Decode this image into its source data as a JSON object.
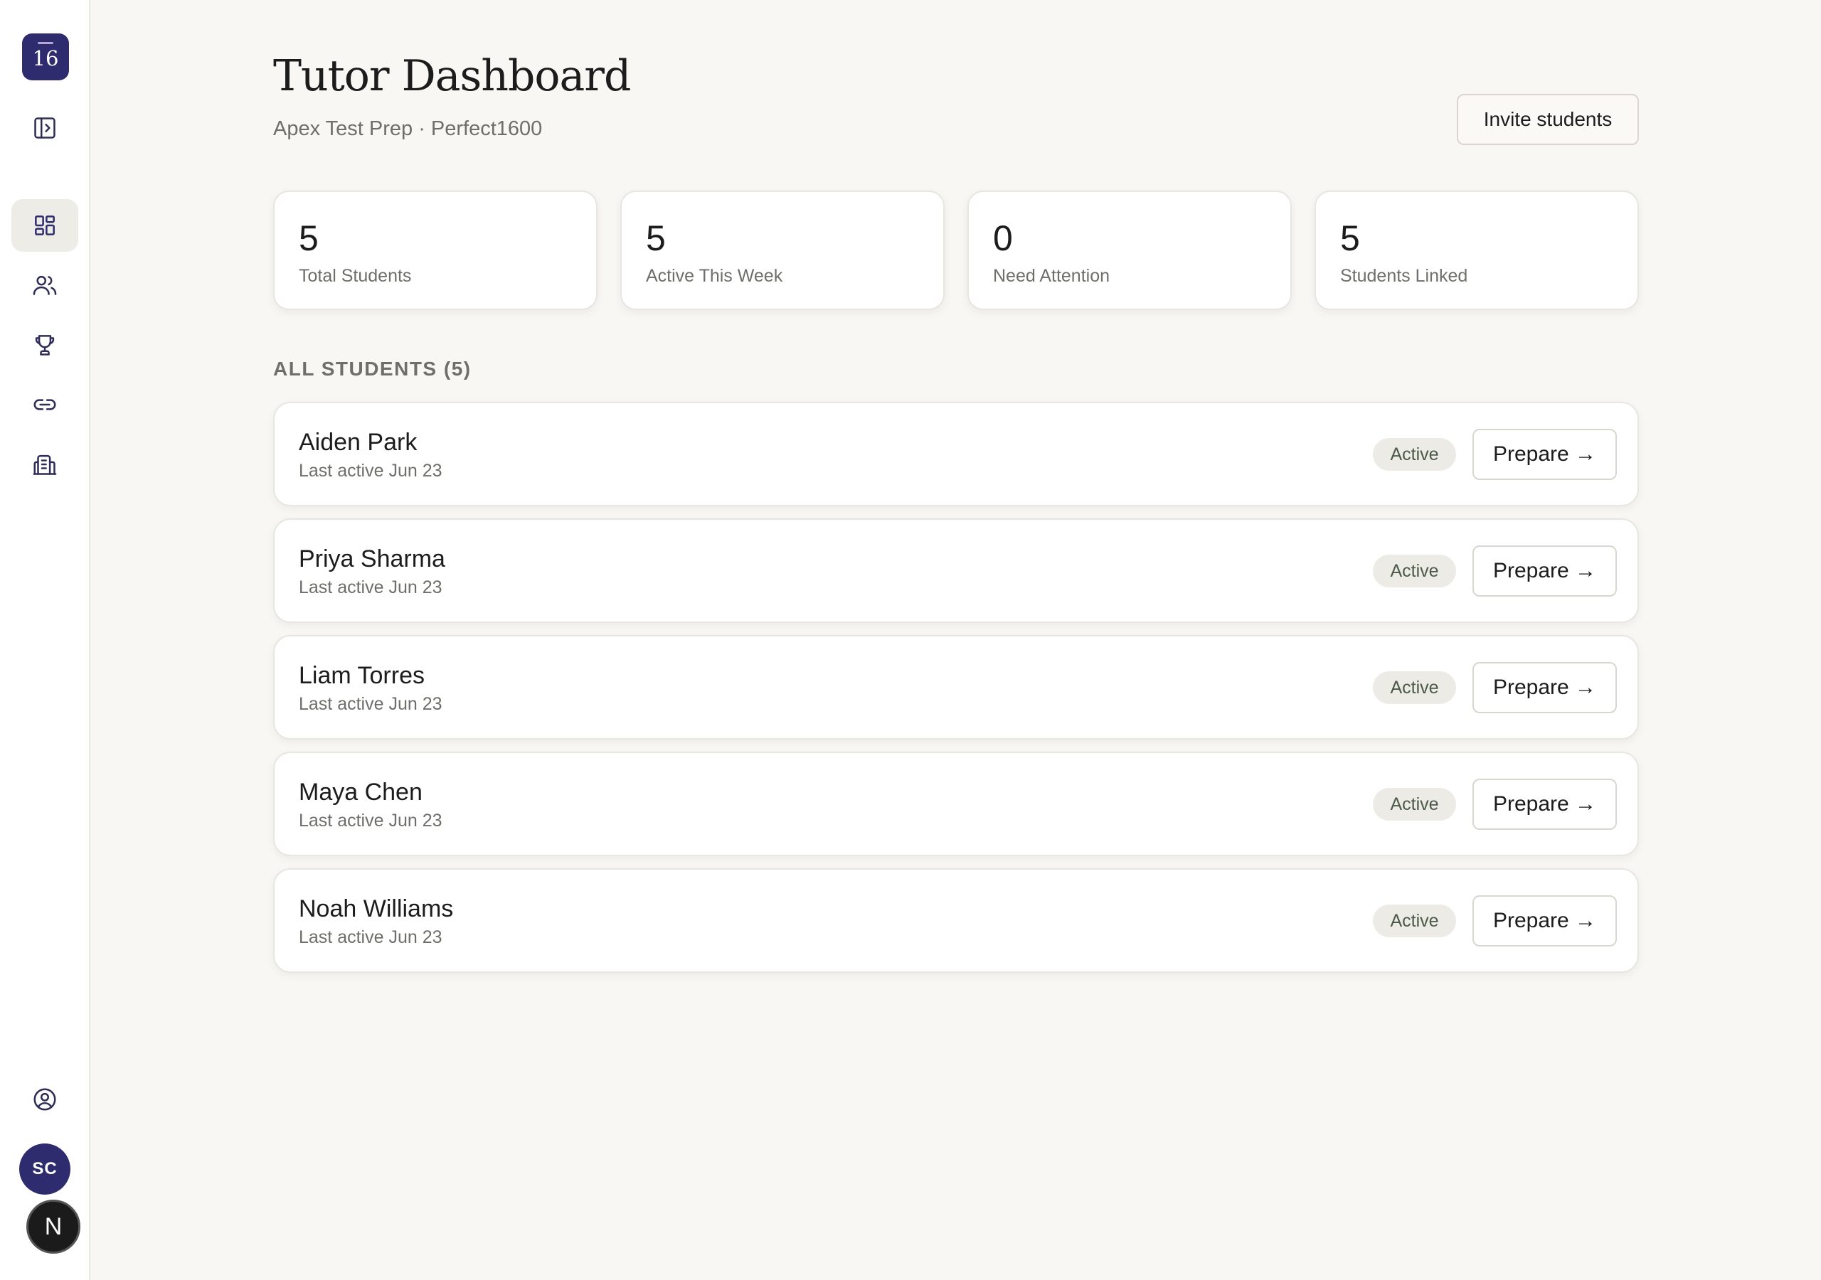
{
  "sidebar": {
    "logo_text": "16",
    "nav_icons": [
      "sidebar-toggle-icon",
      "dashboard-icon",
      "users-icon",
      "trophy-icon",
      "link-icon",
      "building-icon"
    ],
    "account_icon": "user-circle-icon",
    "avatar_initials": "SC",
    "badge_letter": "N"
  },
  "header": {
    "title": "Tutor Dashboard",
    "subtitle": "Apex Test Prep · Perfect1600",
    "invite_label": "Invite students"
  },
  "stats": [
    {
      "value": "5",
      "label": "Total Students"
    },
    {
      "value": "5",
      "label": "Active This Week"
    },
    {
      "value": "0",
      "label": "Need Attention"
    },
    {
      "value": "5",
      "label": "Students Linked"
    }
  ],
  "students_section": {
    "label": "ALL STUDENTS (5)",
    "students": [
      {
        "name": "Aiden Park",
        "last_active": "Last active Jun 23",
        "status": "Active",
        "action": "Prepare →"
      },
      {
        "name": "Priya Sharma",
        "last_active": "Last active Jun 23",
        "status": "Active",
        "action": "Prepare →"
      },
      {
        "name": "Liam Torres",
        "last_active": "Last active Jun 23",
        "status": "Active",
        "action": "Prepare →"
      },
      {
        "name": "Maya Chen",
        "last_active": "Last active Jun 23",
        "status": "Active",
        "action": "Prepare →"
      },
      {
        "name": "Noah Williams",
        "last_active": "Last active Jun 23",
        "status": "Active",
        "action": "Prepare →"
      }
    ]
  },
  "colors": {
    "brand": "#2e2c6e",
    "background": "#f8f7f3",
    "status_badge_bg": "#ecebe5",
    "status_badge_text": "#4c5a4a"
  }
}
